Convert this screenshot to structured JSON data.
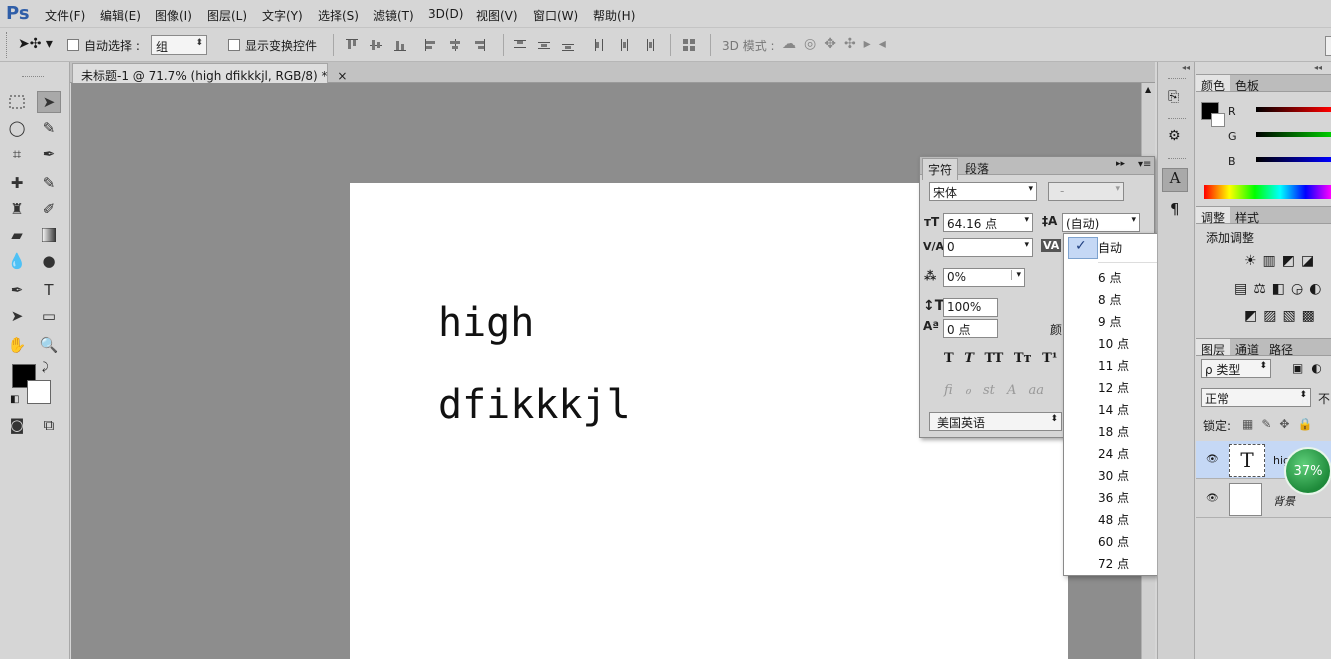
{
  "app": {
    "logo": "Ps",
    "menus": [
      "文件(F)",
      "编辑(E)",
      "图像(I)",
      "图层(L)",
      "文字(Y)",
      "选择(S)",
      "滤镜(T)",
      "3D(D)",
      "视图(V)",
      "窗口(W)",
      "帮助(H)"
    ]
  },
  "options_bar": {
    "auto_select_label": "自动选择 :",
    "auto_select_value": "组",
    "show_transform_label": "显示变换控件",
    "mode_3d_label": "3D 模式 :"
  },
  "document": {
    "tab_title": "未标题-1 @ 71.7% (high dfikkkjl, RGB/8) *",
    "tab_close": "×",
    "text_line1": "high",
    "text_line2": "dfikkkjl"
  },
  "character_panel": {
    "tabs": [
      "字符",
      "段落"
    ],
    "font_family": "宋体",
    "font_style": "-",
    "font_size": "64.16 点",
    "leading": "(自动)",
    "kerning": "0",
    "tracking_scale": "0%",
    "vertical_scale": "100%",
    "baseline_shift": "0 点",
    "color_label": "颜",
    "language": "美国英语",
    "style_buttons": [
      "T",
      "T",
      "TT",
      "Tт",
      "T¹"
    ],
    "opentype_buttons": [
      "ﬁ",
      "ℴ",
      "st",
      "A",
      "aa"
    ]
  },
  "leading_dropdown": {
    "selected_mark": "✓",
    "items": [
      "自动",
      "6 点",
      "8 点",
      "9 点",
      "10 点",
      "11 点",
      "12 点",
      "14 点",
      "18 点",
      "24 点",
      "30 点",
      "36 点",
      "48 点",
      "60 点",
      "72 点"
    ]
  },
  "color_panel": {
    "tabs": [
      "颜色",
      "色板"
    ],
    "channels": [
      "R",
      "G",
      "B"
    ]
  },
  "adjust_panel": {
    "tabs": [
      "调整",
      "样式"
    ],
    "title": "添加调整"
  },
  "layers_panel": {
    "tabs": [
      "图层",
      "通道",
      "路径"
    ],
    "filter_label": "ρ 类型",
    "blend_mode": "正常",
    "opacity_partial": "不",
    "lock_label": "锁定:",
    "layers": [
      {
        "name": "hig",
        "type": "text"
      },
      {
        "name": "背景",
        "type": "background"
      }
    ],
    "badge": "37%"
  },
  "colors": {
    "accent_blue": "#2f5ea8",
    "selection": "#c5d8f5",
    "badge_green": "#1e8a3a"
  }
}
